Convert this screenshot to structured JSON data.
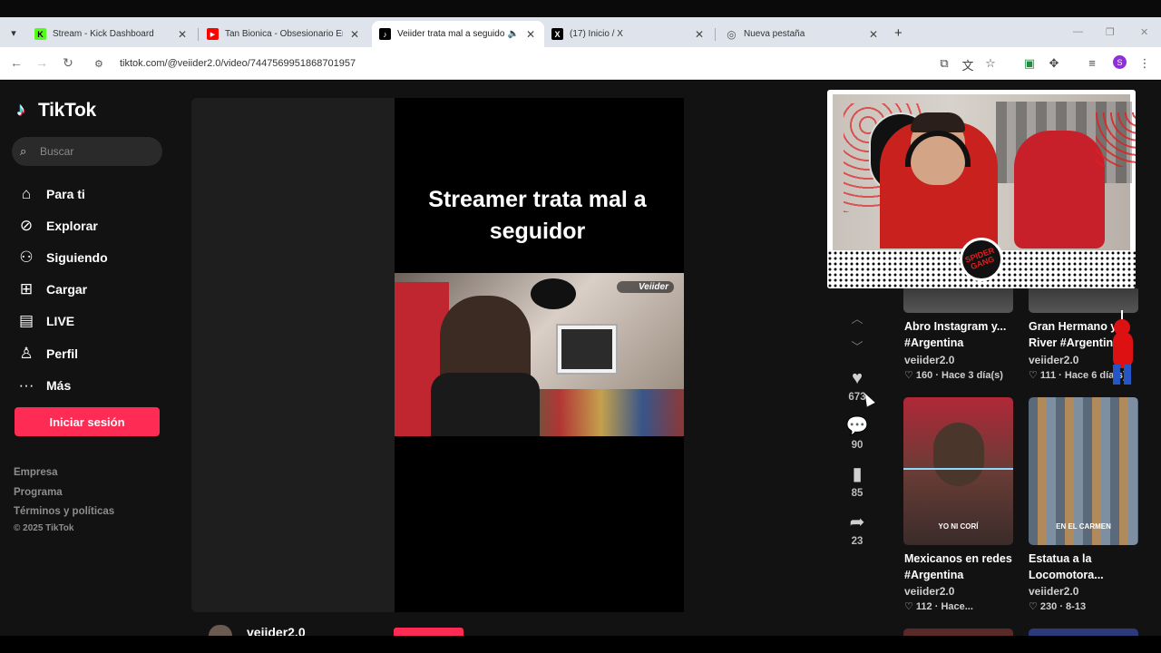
{
  "browser": {
    "tabs": [
      {
        "title": "Stream - Kick Dashboard",
        "favicon_color": "#53fc18",
        "favicon_glyph": "K",
        "active": false
      },
      {
        "title": "Tan Bionica - Obsesionario En L",
        "favicon_color": "#ff0000",
        "favicon_glyph": "▶",
        "active": false
      },
      {
        "title": "Veiider trata mal a seguidor",
        "favicon_color": "#000000",
        "favicon_glyph": "♪",
        "active": true
      },
      {
        "title": "(17) Inicio / X",
        "favicon_color": "#000000",
        "favicon_glyph": "X",
        "active": false
      },
      {
        "title": "Nueva pestaña",
        "favicon_color": "#666666",
        "favicon_glyph": "◎",
        "active": false
      }
    ],
    "url": "tiktok.com/@veiider2.0/video/7447569951868701957",
    "profile_initial": "S",
    "profile_color": "#8e2fd9"
  },
  "sidebar": {
    "logo": "TikTok",
    "search_placeholder": "Buscar",
    "nav": [
      {
        "icon": "home-icon",
        "label": "Para ti"
      },
      {
        "icon": "compass-icon",
        "label": "Explorar"
      },
      {
        "icon": "following-icon",
        "label": "Siguiendo"
      },
      {
        "icon": "upload-icon",
        "label": "Cargar"
      },
      {
        "icon": "live-icon",
        "label": "LIVE"
      },
      {
        "icon": "profile-icon",
        "label": "Perfil"
      },
      {
        "icon": "more-icon",
        "label": "Más"
      }
    ],
    "login_label": "Iniciar sesión",
    "footer_links": [
      "Empresa",
      "Programa",
      "Términos y políticas"
    ],
    "copyright": "© 2025 TikTok",
    "accent": "#fe2c55"
  },
  "video": {
    "caption": "Streamer trata mal a seguidor",
    "watermark": "Veiider",
    "author": "veiider2.0"
  },
  "actions": {
    "likes": "673",
    "comments": "90",
    "saves": "85",
    "shares": "23"
  },
  "related": [
    {
      "title": "Abro Instagram y... #Argentina",
      "title_l1": "Abro Instagram y...",
      "title_l2": "#Argentina",
      "author": "veiider2.0",
      "stats": "160 · Hace 3 día(s)"
    },
    {
      "title": "Gran Hermano y River #Argentina",
      "title_l1": "Gran Hermano y",
      "title_l2": "River #Argentina",
      "author": "veiider2.0",
      "stats": "111 · Hace 6 día(s)"
    },
    {
      "title": "Mexicanos en redes #Argentina",
      "title_l1": "Mexicanos en redes",
      "title_l2": "#Argentina",
      "author": "veiider2.0",
      "stats": "112 · Hace...",
      "thumb_text": "YO NI CORÍ"
    },
    {
      "title": "Estatua a la Locomotora...",
      "title_l1": "Estatua a la",
      "title_l2": "Locomotora...",
      "author": "veiider2.0",
      "stats": "230 · 8-13",
      "thumb_text": "EN EL CARMEN"
    }
  ],
  "overlay": {
    "badge_text": "SPIDER GANG"
  }
}
